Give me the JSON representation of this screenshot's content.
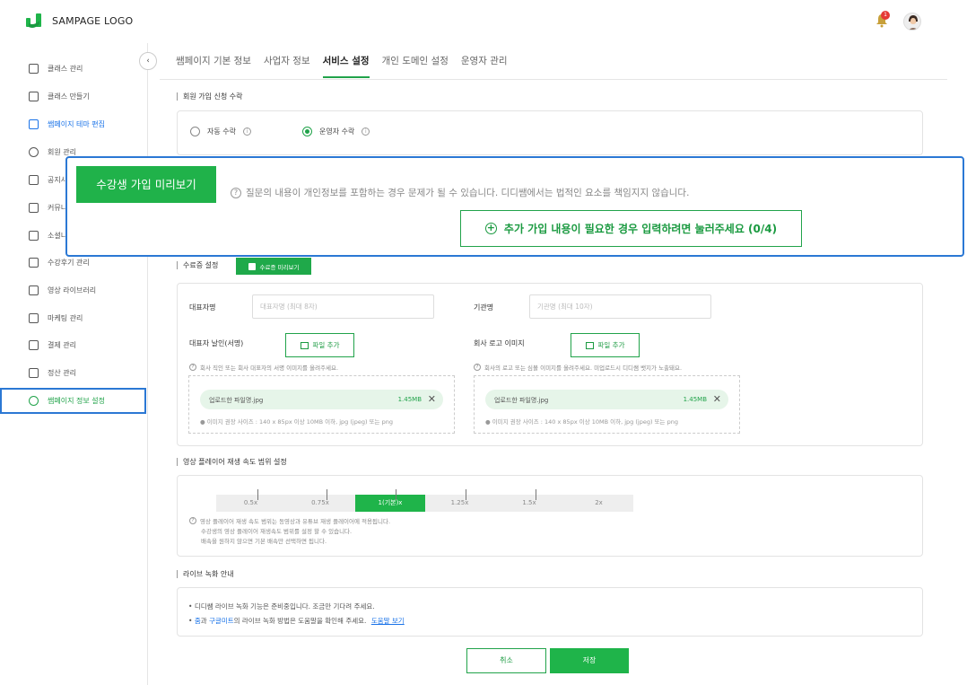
{
  "header": {
    "logo_text": "SAMPAGE LOGO",
    "notification_count": "1"
  },
  "sidebar": {
    "items": [
      {
        "label": "클래스 관리",
        "icon": "graduation-cap-icon"
      },
      {
        "label": "클래스 만들기",
        "icon": "plus-square-icon"
      },
      {
        "label": "쌤페이지 테마 편집",
        "icon": "theme-icon"
      },
      {
        "label": "회원 관리",
        "icon": "user-circle-icon"
      },
      {
        "label": "공지사",
        "icon": "notice-icon"
      },
      {
        "label": "커뮤니",
        "icon": "chat-icon"
      },
      {
        "label": "소셜니",
        "icon": "edit-icon"
      },
      {
        "label": "수강후기 관리",
        "icon": "comment-icon"
      },
      {
        "label": "영상 라이브러리",
        "icon": "video-icon"
      },
      {
        "label": "마케팅 관리",
        "icon": "gift-icon"
      },
      {
        "label": "결제 관리",
        "icon": "payment-icon"
      },
      {
        "label": "정산 관리",
        "icon": "chart-icon"
      },
      {
        "label": "쌤페이지 정보 설정",
        "icon": "gear-icon"
      }
    ],
    "collapse_glyph": "‹"
  },
  "tabs": [
    "쌤페이지 기본 정보",
    "사업자 정보",
    "서비스 설정",
    "개인 도메인 설정",
    "운영자 관리"
  ],
  "signup": {
    "title": "회원 가입 신청 수락",
    "auto_label": "자동 수락",
    "operator_label": "운영자 수락"
  },
  "overlay": {
    "preview_button": "수강생 가입 미리보기",
    "warning": "질문의 내용이 개인정보를 포함하는 경우 문제가 될 수 있습니다. 디디쌤에서는 법적인 요소를 책임지지 않습니다.",
    "add_button": "추가 가입 내용이 필요한 경우 입력하려면 눌러주세요 (0/4)"
  },
  "certificate": {
    "title": "수료증 설정",
    "preview_button": "수료증 미리보기",
    "rep_name_label": "대표자명",
    "rep_name_placeholder": "대표자명 (최대 8자)",
    "org_label": "기관명",
    "org_placeholder": "기관명 (최대 10자)",
    "seal_label": "대표자 날인(서명)",
    "logo_label": "회사 로고 이미지",
    "file_add": "파일 추가",
    "seal_help": "회사 직인 또는 회사 대표자의 서명 이미지를 올려주세요.",
    "logo_help": "회사의 로고 또는 심볼 이미지를 올려주세요. 미업로드시 디디쌤 뱃지가 노출돼요.",
    "file_name": "업로드한 파일명.jpg",
    "file_size": "1.45MB",
    "file_note": "● 이미지 권장 사이즈 : 140 x 85px 이상 10MB 이하, jpg (jpeg) 또는 png"
  },
  "speed": {
    "title": "영상 플레이어 재생 속도 범위 설정",
    "options": [
      "0.5x",
      "0.75x",
      "1(기본)x",
      "1.25x",
      "1.5x",
      "2x"
    ],
    "selected": "1(기본)x",
    "help1": "영상 플레이어 재생 속도 범위는 동영상과 유튜브 재생 플레이어에 적용됩니다.",
    "help2": "수강생의 영상 플레이어 재생속도 범위를 설정 할 수 있습니다.",
    "help3": "배속을 원하지 않으면 기본 배속만 선택하면 됩니다."
  },
  "live": {
    "title": "라이브 녹화 안내",
    "line1": "디디쌤 라이브 녹화 기능은 준비중입니다. 조금만 기다려 주세요.",
    "line2_zoom": "줌",
    "line2_mid": "과",
    "line2_meet": "구글미트",
    "line2_rest": "의 라이브 녹화 방법은 도움말을 확인해 주세요.",
    "help_link": "도움말 보기"
  },
  "footer": {
    "cancel": "취소",
    "save": "저장"
  },
  "colors": {
    "accent_green": "#1fb44a",
    "highlight_blue": "#2b78d4",
    "link_blue": "#1a73e8"
  }
}
